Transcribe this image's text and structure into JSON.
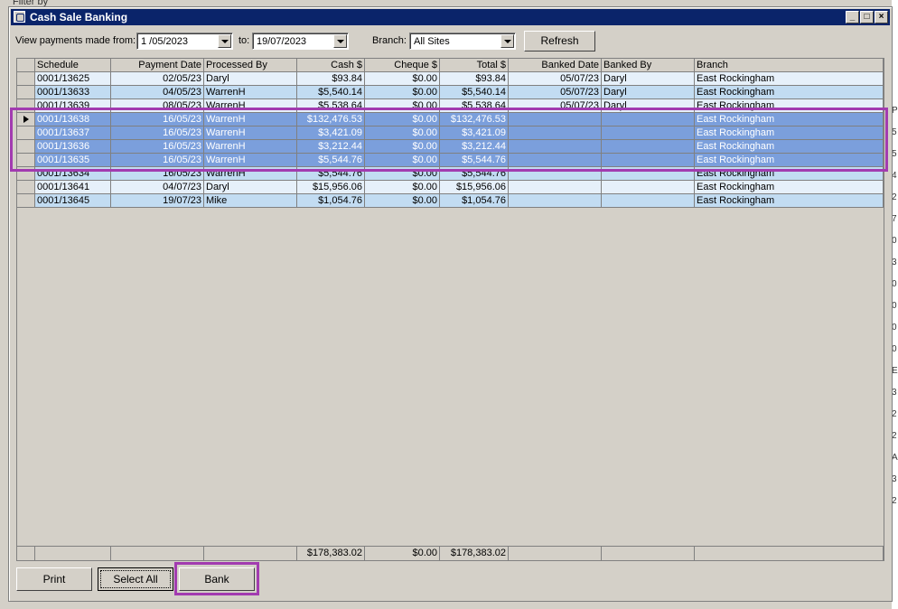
{
  "window": {
    "title": "Cash Sale Banking"
  },
  "filter": {
    "from_label": "View payments made from:",
    "from_value": "1 /05/2023",
    "to_label": "to:",
    "to_value": "19/07/2023",
    "branch_label": "Branch:",
    "branch_value": "All Sites",
    "refresh_label": "Refresh"
  },
  "grid": {
    "columns": [
      "Schedule",
      "Payment Date",
      "Processed By",
      "Cash $",
      "Cheque $",
      "Total $",
      "Banked Date",
      "Banked By",
      "Branch"
    ],
    "rows": [
      [
        "0001/13625",
        "02/05/23",
        "Daryl",
        "$93.84",
        "$0.00",
        "$93.84",
        "05/07/23",
        "Daryl",
        "East Rockingham"
      ],
      [
        "0001/13633",
        "04/05/23",
        "WarrenH",
        "$5,540.14",
        "$0.00",
        "$5,540.14",
        "05/07/23",
        "Daryl",
        "East Rockingham"
      ],
      [
        "0001/13639",
        "08/05/23",
        "WarrenH",
        "$5,538.64",
        "$0.00",
        "$5,538.64",
        "05/07/23",
        "Daryl",
        "East Rockingham"
      ],
      [
        "0001/13638",
        "16/05/23",
        "WarrenH",
        "$132,476.53",
        "$0.00",
        "$132,476.53",
        "",
        "",
        "East Rockingham"
      ],
      [
        "0001/13637",
        "16/05/23",
        "WarrenH",
        "$3,421.09",
        "$0.00",
        "$3,421.09",
        "",
        "",
        "East Rockingham"
      ],
      [
        "0001/13636",
        "16/05/23",
        "WarrenH",
        "$3,212.44",
        "$0.00",
        "$3,212.44",
        "",
        "",
        "East Rockingham"
      ],
      [
        "0001/13635",
        "16/05/23",
        "WarrenH",
        "$5,544.76",
        "$0.00",
        "$5,544.76",
        "",
        "",
        "East Rockingham"
      ],
      [
        "0001/13634",
        "16/05/23",
        "WarrenH",
        "$5,544.76",
        "$0.00",
        "$5,544.76",
        "",
        "",
        "East Rockingham"
      ],
      [
        "0001/13641",
        "04/07/23",
        "Daryl",
        "$15,956.06",
        "$0.00",
        "$15,956.06",
        "",
        "",
        "East Rockingham"
      ],
      [
        "0001/13645",
        "19/07/23",
        "Mike",
        "$1,054.76",
        "$0.00",
        "$1,054.76",
        "",
        "",
        "East Rockingham"
      ]
    ],
    "totals": {
      "cash": "$178,383.02",
      "cheque": "$0.00",
      "total": "$178,383.02"
    }
  },
  "buttons": {
    "print": "Print",
    "select_all": "Select All",
    "bank": "Bank"
  },
  "background": {
    "filter_text": "Filter by",
    "right_edge_glyphs": [
      "P",
      "5",
      "5",
      "4",
      "2",
      "7",
      "0",
      "3",
      "0",
      "0",
      "0",
      "0",
      "E",
      "3",
      "2",
      "2",
      "A",
      "3",
      "2"
    ]
  },
  "colors": {
    "title_bar": "#0a246a",
    "selected_row": "#7b9fdc",
    "highlight": "#a23bb0"
  }
}
